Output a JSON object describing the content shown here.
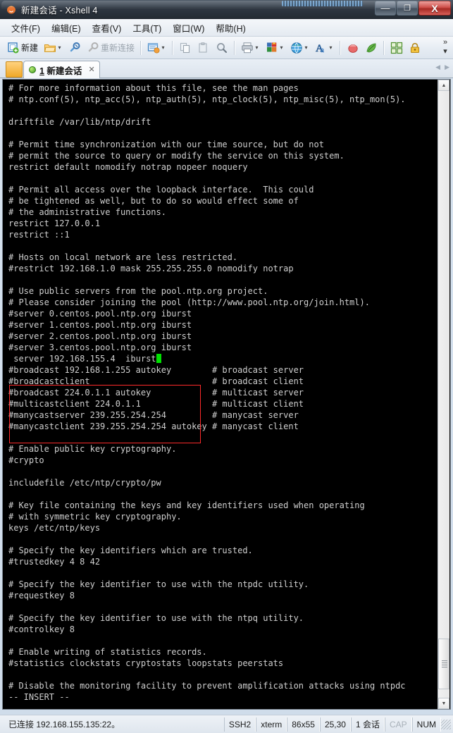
{
  "window": {
    "title": "新建会话 - Xshell 4",
    "icon": "xshell-logo-icon",
    "buttons": {
      "minimize": "—",
      "maximize": "❐",
      "close": "X"
    }
  },
  "menubar": {
    "items": [
      {
        "label": "文件(F)",
        "name": "menu-file"
      },
      {
        "label": "编辑(E)",
        "name": "menu-edit"
      },
      {
        "label": "查看(V)",
        "name": "menu-view"
      },
      {
        "label": "工具(T)",
        "name": "menu-tools"
      },
      {
        "label": "窗口(W)",
        "name": "menu-window"
      },
      {
        "label": "帮助(H)",
        "name": "menu-help"
      }
    ]
  },
  "toolbar": {
    "new_label": "新建",
    "reconnect_label": "重新连接",
    "overflow_label": "»",
    "dropdown_arrow": "▾"
  },
  "tabs": {
    "items": [
      {
        "index": "1",
        "label": " 新建会话",
        "close": "✕"
      }
    ],
    "nav_prev": "◀",
    "nav_next": "▶"
  },
  "terminal": {
    "lines": [
      "# For more information about this file, see the man pages",
      "# ntp.conf(5), ntp_acc(5), ntp_auth(5), ntp_clock(5), ntp_misc(5), ntp_mon(5).",
      "",
      "driftfile /var/lib/ntp/drift",
      "",
      "# Permit time synchronization with our time source, but do not",
      "# permit the source to query or modify the service on this system.",
      "restrict default nomodify notrap nopeer noquery",
      "",
      "# Permit all access over the loopback interface.  This could",
      "# be tightened as well, but to do so would effect some of",
      "# the administrative functions.",
      "restrict 127.0.0.1",
      "restrict ::1",
      "",
      "# Hosts on local network are less restricted.",
      "#restrict 192.168.1.0 mask 255.255.255.0 nomodify notrap",
      "",
      "# Use public servers from the pool.ntp.org project.",
      "# Please consider joining the pool (http://www.pool.ntp.org/join.html).",
      "#server 0.centos.pool.ntp.org iburst",
      "#server 1.centos.pool.ntp.org iburst",
      "#server 2.centos.pool.ntp.org iburst",
      "#server 3.centos.pool.ntp.org iburst",
      " server 192.168.155.4  iburst",
      "#broadcast 192.168.1.255 autokey        # broadcast server",
      "#broadcastclient                        # broadcast client",
      "#broadcast 224.0.1.1 autokey            # multicast server",
      "#multicastclient 224.0.1.1              # multicast client",
      "#manycastserver 239.255.254.254         # manycast server",
      "#manycastclient 239.255.254.254 autokey # manycast client",
      "",
      "# Enable public key cryptography.",
      "#crypto",
      "",
      "includefile /etc/ntp/crypto/pw",
      "",
      "# Key file containing the keys and key identifiers used when operating",
      "# with symmetric key cryptography.",
      "keys /etc/ntp/keys",
      "",
      "# Specify the key identifiers which are trusted.",
      "#trustedkey 4 8 42",
      "",
      "# Specify the key identifier to use with the ntpdc utility.",
      "#requestkey 8",
      "",
      "# Specify the key identifier to use with the ntpq utility.",
      "#controlkey 8",
      "",
      "# Enable writing of statistics records.",
      "#statistics clockstats cryptostats loopstats peerstats",
      "",
      "# Disable the monitoring facility to prevent amplification attacks using ntpdc",
      "-- INSERT --"
    ],
    "cursor_line_index": 24,
    "highlight": {
      "color": "#ff2b2b",
      "start_line_index": 20,
      "end_line_index": 24
    },
    "colors": {
      "background": "#000000",
      "foreground": "#cfcfcf",
      "cursor": "#00e000"
    }
  },
  "statusbar": {
    "connection": "已连接 192.168.155.135:22。",
    "protocol": "SSH2",
    "emulation": "xterm",
    "size": "86x55",
    "position": "25,30",
    "sessions": "1 会话",
    "caps": "CAP",
    "num": "NUM"
  }
}
